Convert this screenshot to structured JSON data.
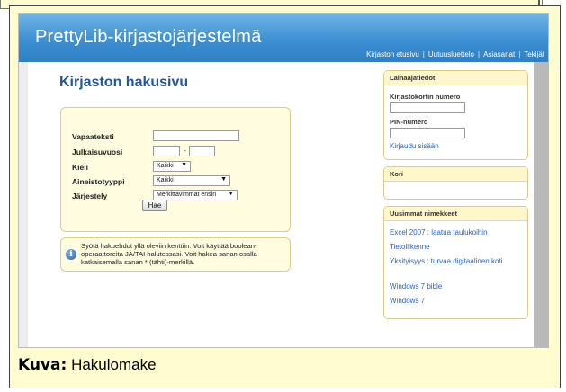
{
  "app": {
    "title": "PrettyLib-kirjastojärjestelmä",
    "nav": [
      "Kirjaston etusivu",
      "Uutuusluettelo",
      "Asiasanat",
      "Tekijät"
    ]
  },
  "page": {
    "title": "Kirjaston hakusivu"
  },
  "search_form": {
    "free_text_label": "Vapaateksti",
    "free_text_value": "",
    "year_label": "Julkaisuvuosi",
    "year_from_value": "",
    "year_to_value": "",
    "year_separator": "-",
    "language_label": "Kieli",
    "language_value": "Kaikki",
    "material_label": "Aineistotyyppi",
    "material_value": "Kaikki",
    "sort_label": "Järjestely",
    "sort_value": "Merkittävimmät ensin",
    "search_button": "Hae"
  },
  "info": {
    "text": "Syötä hakuehdot yllä oleviin kenttiin. Voit käyttää boolean-operaattoreita JA/TAI halutessasi. Voit hakea sanan osalla katkaisemalla sanan * (tähti)-merkillä."
  },
  "login": {
    "header": "Lainaajatiedot",
    "card_label": "Kirjastokortin numero",
    "card_value": "",
    "pin_label": "PIN-numero",
    "pin_value": "",
    "login_link": "Kirjaudu sisään"
  },
  "cart": {
    "header": "Kori"
  },
  "newest": {
    "header": "Uusimmat nimekkeet",
    "items": [
      "Excel 2007 : laatua taulukoihin",
      "Tietoliikenne",
      "Yksityisyys : turvaa digitaalinen koti.",
      "Windows 7 bible",
      "Windows 7"
    ]
  },
  "caption": {
    "prefix": "Kuva:",
    "text": "Hakulomake"
  },
  "colors": {
    "header_blue": "#3c8fd2",
    "title_blue": "#21569a",
    "link_blue": "#2a62b8",
    "doc_yellow": "#fffccf",
    "box_yellow": "#fffce0"
  }
}
